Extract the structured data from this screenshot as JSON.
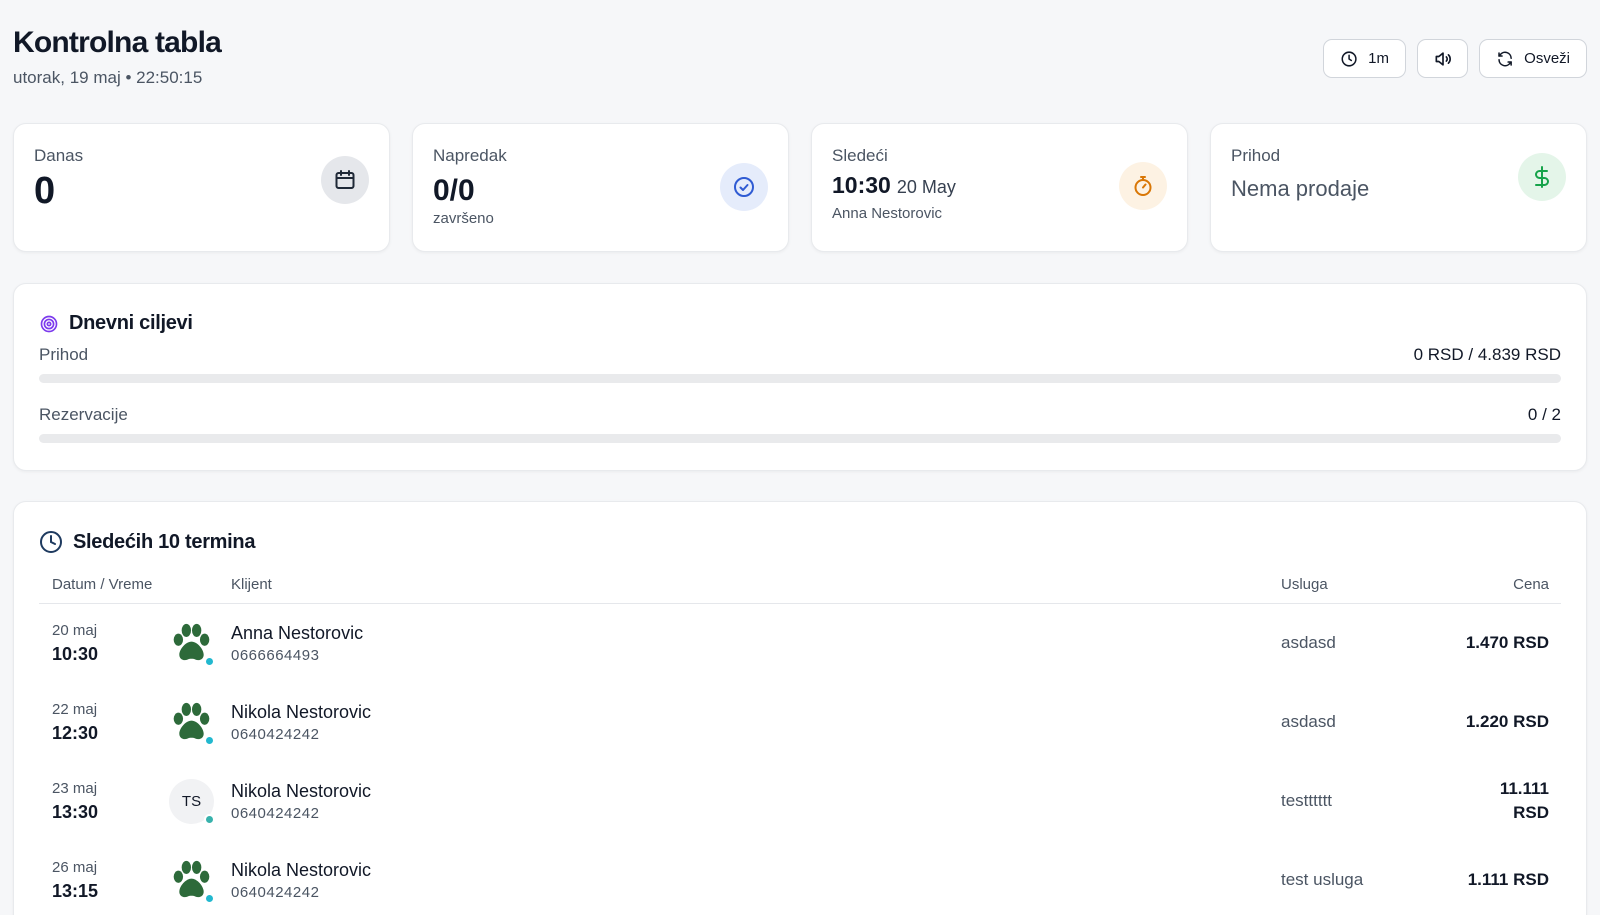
{
  "header": {
    "title": "Kontrolna tabla",
    "subtitle": "utorak, 19 maj • 22:50:15",
    "timer_label": "1m",
    "refresh_label": "Osveži"
  },
  "stats": {
    "today": {
      "label": "Danas",
      "value": "0"
    },
    "progress": {
      "label": "Napredak",
      "value": "0/0",
      "sub": "završeno"
    },
    "next": {
      "label": "Sledeći",
      "time": "10:30",
      "date": "20 May",
      "client": "Anna Nestorovic"
    },
    "revenue": {
      "label": "Prihod",
      "value": "Nema prodaje"
    }
  },
  "goals": {
    "title": "Dnevni ciljevi",
    "items": [
      {
        "label": "Prihod",
        "value": "0 RSD / 4.839 RSD",
        "progress": 0
      },
      {
        "label": "Rezervacije",
        "value": "0 / 2",
        "progress": 0
      }
    ]
  },
  "appointments": {
    "title": "Sledećih 10 termina",
    "columns": {
      "datetime": "Datum / Vreme",
      "client": "Klijent",
      "service": "Usluga",
      "price": "Cena"
    },
    "rows": [
      {
        "day": "20 maj",
        "time": "10:30",
        "avatar": "paw-icon",
        "name": "Anna Nestorovic",
        "phone": "0666664493",
        "service": "asdasd",
        "price": "1.470 RSD"
      },
      {
        "day": "22 maj",
        "time": "12:30",
        "avatar": "paw-icon",
        "name": "Nikola Nestorovic",
        "phone": "0640424242",
        "service": "asdasd",
        "price": "1.220 RSD"
      },
      {
        "day": "23 maj",
        "time": "13:30",
        "avatar": "TS",
        "name": "Nikola Nestorovic",
        "phone": "0640424242",
        "service": "testttttt",
        "price": "11.111 RSD"
      },
      {
        "day": "26 maj",
        "time": "13:15",
        "avatar": "paw-icon",
        "name": "Nikola Nestorovic",
        "phone": "0640424242",
        "service": "test usluga",
        "price": "1.111 RSD"
      }
    ]
  },
  "colors": {
    "paw": "#2d6a3a",
    "status_dot": "#22b8cf",
    "goal_icon": "#7c3aed"
  }
}
